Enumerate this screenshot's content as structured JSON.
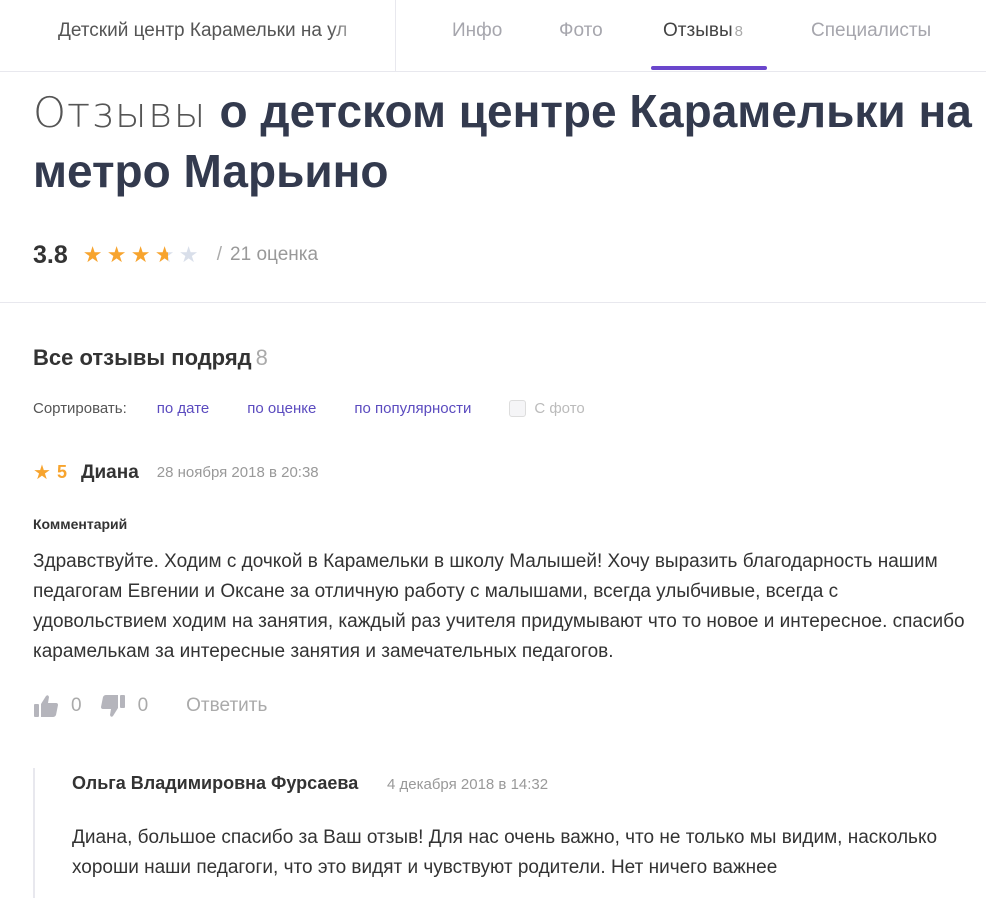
{
  "header": {
    "org_name": "Детский центр Карамельки на ул",
    "tabs": [
      {
        "label": "Инфо"
      },
      {
        "label": "Фото"
      },
      {
        "label": "Отзывы",
        "count": "8"
      },
      {
        "label": "Специалисты"
      }
    ],
    "active_tab": "Отзывы",
    "accent_color": "#6a46cc"
  },
  "page": {
    "title_light": "Отзывы",
    "title_bold": "о детском центре Карамельки на метро Марьино"
  },
  "rating": {
    "value": "3.8",
    "stars_filled": 3.8,
    "stars_total": 5,
    "separator": "/",
    "count_label": "21 оценка",
    "star_color": "#f7a42e"
  },
  "reviews_section": {
    "title": "Все отзывы подряд",
    "count": "8",
    "sort_label": "Сортировать:",
    "sort_options": [
      "по дате",
      "по оценке",
      "по популярности"
    ],
    "photo_filter_label": "С фото"
  },
  "review": {
    "score": "5",
    "author": "Диана",
    "date": "28 ноября 2018 в 20:38",
    "comment_label": "Комментарий",
    "text": "Здравствуйте. Ходим с дочкой в Карамельки в школу Малышей! Хочу выразить благодарность нашим педагогам Евгении и Оксане за отличную работу с малышами, всегда улыбчивые, всегда с удовольствием ходим на занятия, каждый раз учителя придумывают что то новое и интересное. спасибо карамелькам за интересные занятия и замечательных педагогов.",
    "likes": "0",
    "dislikes": "0",
    "reply_label": "Ответить"
  },
  "reply": {
    "author": "Ольга Владимировна Фурсаева",
    "date": "4 декабря 2018 в 14:32",
    "text": "Диана, большое спасибо за Ваш отзыв! Для нас очень важно, что не только мы видим, насколько хороши наши педагоги, что это видят и чувствуют родители. Нет ничего важнее"
  }
}
